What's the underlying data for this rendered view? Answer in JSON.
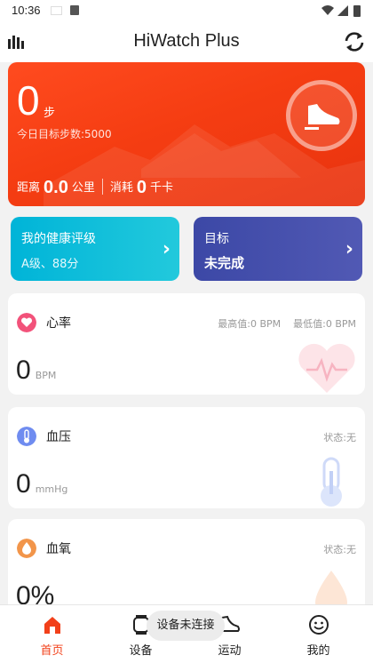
{
  "status_bar": {
    "time": "10:36"
  },
  "header": {
    "title": "HiWatch Plus"
  },
  "steps": {
    "count": "0",
    "unit": "步",
    "goal_text": "今日目标步数:5000",
    "distance_label": "距离",
    "distance_value": "0.0",
    "distance_unit": "公里",
    "calories_label": "消耗",
    "calories_value": "0",
    "calories_unit": "千卡"
  },
  "health_card": {
    "title": "我的健康评级",
    "subtitle": "A级、88分"
  },
  "goal_card": {
    "title": "目标",
    "subtitle": "未完成"
  },
  "metrics": {
    "heart": {
      "title": "心率",
      "max_text": "最高值:0 BPM",
      "min_text": "最低值:0 BPM",
      "value": "0",
      "unit": "BPM"
    },
    "blood_pressure": {
      "title": "血压",
      "status": "状态:无",
      "value": "0",
      "unit": "mmHg"
    },
    "oxygen": {
      "title": "血氧",
      "status": "状态:无",
      "value": "0%"
    }
  },
  "toast": {
    "text": "设备未连接"
  },
  "nav": [
    {
      "label": "首页",
      "icon": "home-icon",
      "active": true
    },
    {
      "label": "设备",
      "icon": "watch-icon",
      "active": false
    },
    {
      "label": "运动",
      "icon": "shoe-icon",
      "active": false
    },
    {
      "label": "我的",
      "icon": "smiley-icon",
      "active": false
    }
  ],
  "colors": {
    "accent": "#f2401a",
    "steps_card": "#f53d12",
    "health_card": "#00b4d8",
    "goal_card": "#3c48a6",
    "heart_icon": "#f2527a",
    "bp_icon": "#6f8cf0",
    "oxygen_icon": "#f2954a"
  }
}
